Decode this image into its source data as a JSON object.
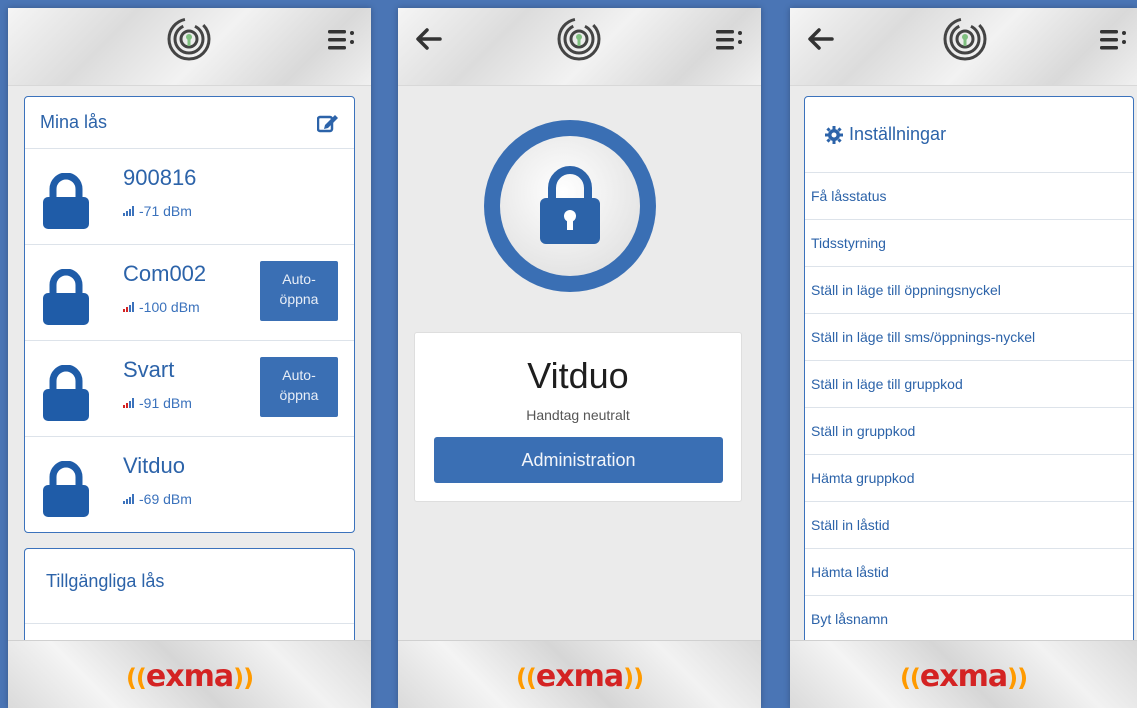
{
  "brand": {
    "name": "exma",
    "red": "#d42323",
    "orange": "#ff9a00",
    "blue": "#3a6fb4"
  },
  "screen1": {
    "my_locks": {
      "title": "Mina lås",
      "edit_icon": "edit-icon",
      "locks": [
        {
          "name": "900816",
          "signal": "-71 dBm",
          "signal_level": "good",
          "auto_open": null
        },
        {
          "name": "Com002",
          "signal": "-100 dBm",
          "signal_level": "weak",
          "auto_open": "Auto-\nöppna"
        },
        {
          "name": "Svart",
          "signal": "-91 dBm",
          "signal_level": "weak",
          "auto_open": "Auto-\nöppna"
        },
        {
          "name": "Vitduo",
          "signal": "-69 dBm",
          "signal_level": "good",
          "auto_open": null
        }
      ]
    },
    "available_locks": {
      "title": "Tillgängliga lås"
    }
  },
  "screen2": {
    "lock_name": "Vitduo",
    "status": "Handtag neutralt",
    "admin_button": "Administration"
  },
  "screen3": {
    "settings_title": "Inställningar",
    "items": [
      "Få låsstatus",
      "Tidsstyrning",
      "Ställ in läge till öppningsnyckel",
      "Ställ in läge till sms/öppnings-nyckel",
      "Ställ in läge till gruppkod",
      "Ställ in gruppkod",
      "Hämta gruppkod",
      "Ställ in låstid",
      "Hämta låstid",
      "Byt låsnamn"
    ]
  }
}
